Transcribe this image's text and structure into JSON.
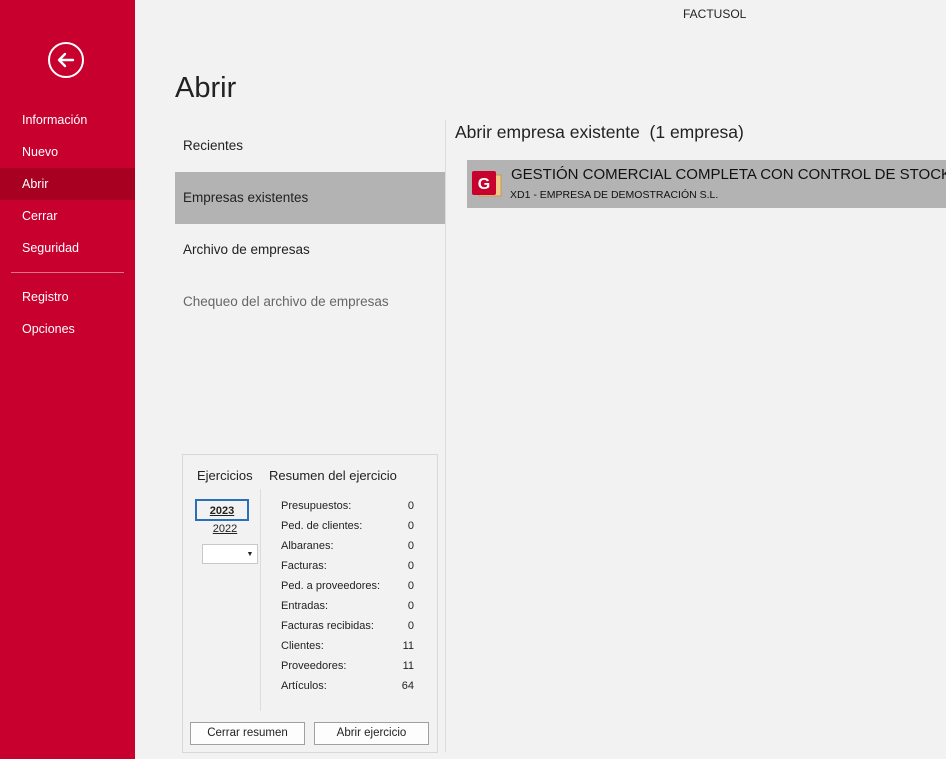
{
  "app": {
    "title": "FACTUSOL"
  },
  "sidebar": {
    "back_icon": "arrow-left-circle-icon",
    "items_top": [
      {
        "label": "Información"
      },
      {
        "label": "Nuevo"
      },
      {
        "label": "Abrir",
        "active": true
      },
      {
        "label": "Cerrar"
      },
      {
        "label": "Seguridad"
      }
    ],
    "items_bottom": [
      {
        "label": "Registro"
      },
      {
        "label": "Opciones"
      }
    ],
    "color": "#c8002d",
    "active_color": "#a70020"
  },
  "page": {
    "title": "Abrir"
  },
  "menu": {
    "items": [
      {
        "label": "Recientes"
      },
      {
        "label": "Empresas existentes",
        "active": true
      },
      {
        "label": "Archivo de empresas"
      },
      {
        "label": "Chequeo del archivo de empresas",
        "disabled": true
      }
    ]
  },
  "right": {
    "title": "Abrir empresa existente  (1 empresa)",
    "company": {
      "name": "GESTIÓN COMERCIAL COMPLETA CON CONTROL DE STOCK",
      "subtitle": "XD1 - EMPRESA DE DEMOSTRACIÓN S.L.",
      "icon": "factusol-folder-icon",
      "icon_letter": "G"
    }
  },
  "exercises": {
    "label": "Ejercicios",
    "summary_label": "Resumen del ejercicio",
    "years": [
      "2023",
      "2022"
    ],
    "selected_year": "2023",
    "combo_value": "",
    "stats": [
      {
        "label": "Presupuestos:",
        "value": "0"
      },
      {
        "label": "Ped. de clientes:",
        "value": "0"
      },
      {
        "label": "Albaranes:",
        "value": "0"
      },
      {
        "label": "Facturas:",
        "value": "0"
      },
      {
        "label": "Ped. a proveedores:",
        "value": "0"
      },
      {
        "label": "Entradas:",
        "value": "0"
      },
      {
        "label": "Facturas recibidas:",
        "value": "0"
      },
      {
        "label": "Clientes:",
        "value": "11"
      },
      {
        "label": "Proveedores:",
        "value": "11"
      },
      {
        "label": "Artículos:",
        "value": "64"
      }
    ],
    "close_button": "Cerrar resumen",
    "open_button": "Abrir ejercicio"
  }
}
